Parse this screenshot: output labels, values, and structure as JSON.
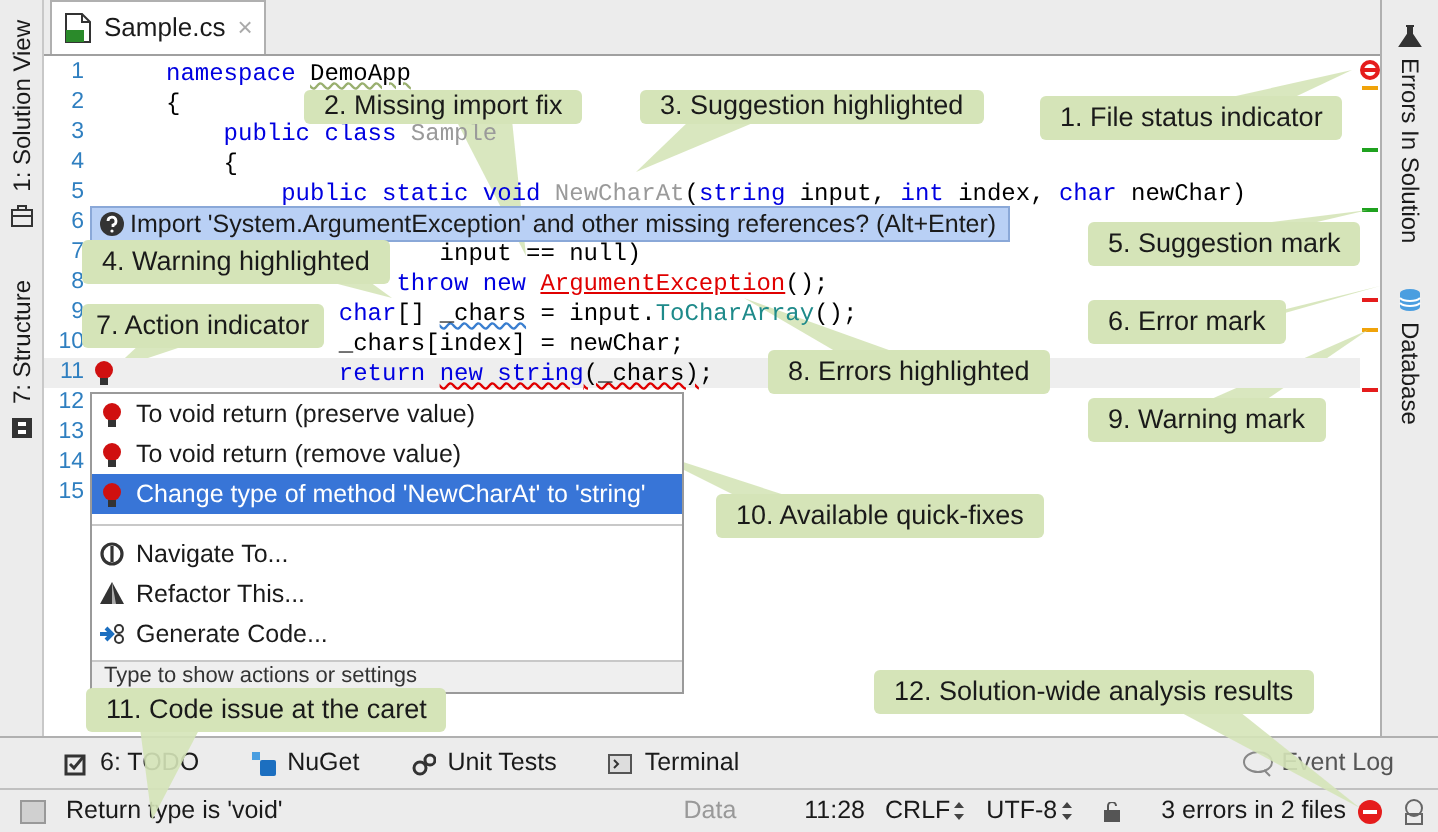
{
  "left_tabs": [
    {
      "label": "1: Solution View"
    },
    {
      "label": "7: Structure"
    }
  ],
  "editor_tab": {
    "label": "Sample.cs",
    "close": "×"
  },
  "code_lines": [
    {
      "number": "1",
      "current": false,
      "bulb": false,
      "tokens": [
        {
          "text": "namespace ",
          "kind": "keyword"
        },
        {
          "text": "DemoApp",
          "kind": "hint"
        }
      ]
    },
    {
      "number": "2",
      "current": false,
      "bulb": false,
      "tokens": [
        {
          "text": "{",
          "kind": "plain"
        }
      ]
    },
    {
      "number": "3",
      "current": false,
      "bulb": false,
      "tokens": [
        {
          "text": "    public class ",
          "kind": "keyword"
        },
        {
          "text": "Sample",
          "kind": "unused"
        }
      ]
    },
    {
      "number": "4",
      "current": false,
      "bulb": false,
      "tokens": [
        {
          "text": "    {",
          "kind": "plain"
        }
      ]
    },
    {
      "number": "5",
      "current": false,
      "bulb": false,
      "tokens": [
        {
          "text": "        public static void ",
          "kind": "keyword"
        },
        {
          "text": "NewCharAt",
          "kind": "unused"
        },
        {
          "text": "(",
          "kind": "plain"
        },
        {
          "text": "string",
          "kind": "keyword"
        },
        {
          "text": " input, ",
          "kind": "plain"
        },
        {
          "text": "int",
          "kind": "keyword"
        },
        {
          "text": " index, ",
          "kind": "plain"
        },
        {
          "text": "char",
          "kind": "keyword"
        },
        {
          "text": " newChar)",
          "kind": "plain"
        }
      ]
    },
    {
      "number": "6",
      "current": false,
      "bulb": false
    },
    {
      "number": "7",
      "current": false,
      "bulb": false,
      "tokens": [
        {
          "text": "                   input == null)",
          "kind": "plain"
        }
      ]
    },
    {
      "number": "8",
      "current": false,
      "bulb": false,
      "tokens": [
        {
          "text": "                throw new ",
          "kind": "keyword"
        },
        {
          "text": "ArgumentException",
          "kind": "error"
        },
        {
          "text": "();",
          "kind": "plain"
        }
      ]
    },
    {
      "number": "9",
      "current": false,
      "bulb": false,
      "tokens": [
        {
          "text": "            char",
          "kind": "keyword"
        },
        {
          "text": "[] ",
          "kind": "plain"
        },
        {
          "text": "_chars",
          "kind": "suggestion"
        },
        {
          "text": " = input.",
          "kind": "plain"
        },
        {
          "text": "ToCharArray",
          "kind": "method"
        },
        {
          "text": "();",
          "kind": "plain"
        }
      ]
    },
    {
      "number": "10",
      "current": false,
      "bulb": false,
      "tokens": [
        {
          "text": "            _chars[index] = newChar;",
          "kind": "plain"
        }
      ]
    },
    {
      "number": "11",
      "current": true,
      "bulb": true,
      "tokens": [
        {
          "text": "            return ",
          "kind": "keyword"
        },
        {
          "text": "new string",
          "kind": "invalid_keyword"
        },
        {
          "text": "(_chars)",
          "kind": "invalid"
        },
        {
          "text": ";",
          "kind": "plain"
        }
      ]
    },
    {
      "number": "12",
      "current": false,
      "bulb": false
    },
    {
      "number": "13",
      "current": false,
      "bulb": false
    },
    {
      "number": "14",
      "current": false,
      "bulb": false
    },
    {
      "number": "15",
      "current": false,
      "bulb": false
    }
  ],
  "stripe_marks": [
    {
      "color": "#f0a30a"
    },
    {
      "color": "#1fa21f"
    },
    {
      "color": "#1fa21f"
    },
    {
      "color": "#e51c1c"
    },
    {
      "color": "#f0a30a"
    },
    {
      "color": "#e51c1c"
    }
  ],
  "right_tabs": [
    {
      "label": "Errors In Solution"
    },
    {
      "label": "Database"
    }
  ],
  "import_hint": {
    "text": "Import 'System.ArgumentException' and other missing references? (Alt+Enter)"
  },
  "quick_menu": {
    "items": [
      {
        "kind": "quickfix",
        "label": "To void return (preserve value)",
        "selected": false
      },
      {
        "kind": "quickfix",
        "label": "To void return (remove value)",
        "selected": false
      },
      {
        "kind": "quickfix",
        "label": "Change type of method 'NewCharAt' to 'string'",
        "selected": true
      },
      {
        "kind": "navigate",
        "label": "Navigate To...",
        "selected": false
      },
      {
        "kind": "refactor",
        "label": "Refactor This...",
        "selected": false
      },
      {
        "kind": "generate",
        "label": "Generate Code...",
        "selected": false
      }
    ],
    "footer": "Type to show actions or settings"
  },
  "tool_windows": [
    {
      "label": "6: TODO"
    },
    {
      "label": "NuGet"
    },
    {
      "label": "Unit Tests"
    },
    {
      "label": "Terminal"
    }
  ],
  "event_log": "Event Log",
  "status_bar": {
    "message": "Return type is 'void'",
    "data": "Data",
    "position": "11:28",
    "line_ending": "CRLF",
    "encoding": "UTF-8",
    "errors": "3 errors in 2 files"
  },
  "callouts": [
    {
      "text": "2. Missing import fix"
    },
    {
      "text": "3. Suggestion highlighted"
    },
    {
      "text": "1. File status indicator"
    },
    {
      "text": "5. Suggestion mark"
    },
    {
      "text": "4. Warning highlighted"
    },
    {
      "text": "6. Error mark"
    },
    {
      "text": "7. Action indicator"
    },
    {
      "text": "8. Errors highlighted"
    },
    {
      "text": "9. Warning mark"
    },
    {
      "text": "10. Available quick-fixes"
    },
    {
      "text": "12. Solution-wide analysis results"
    },
    {
      "text": "11. Code issue at the caret"
    }
  ]
}
